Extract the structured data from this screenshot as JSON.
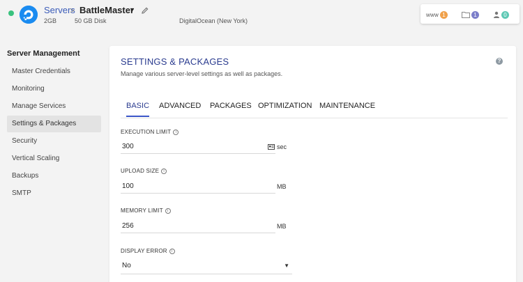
{
  "header": {
    "breadcrumb_root": "Servers",
    "breadcrumb_sep": ">",
    "server_name": "BattleMaster",
    "ram": "2GB",
    "disk": "50 GB Disk",
    "provider": "DigitalOcean (New York)",
    "status_color": "#3ac27e",
    "actions": {
      "www_label": "www",
      "www_count": "1",
      "files_count": "1",
      "users_count": "0"
    }
  },
  "sidebar": {
    "title": "Server Management",
    "items": [
      {
        "label": "Master Credentials"
      },
      {
        "label": "Monitoring"
      },
      {
        "label": "Manage Services"
      },
      {
        "label": "Settings & Packages",
        "active": true
      },
      {
        "label": "Security"
      },
      {
        "label": "Vertical Scaling"
      },
      {
        "label": "Backups"
      },
      {
        "label": "SMTP"
      }
    ]
  },
  "main": {
    "title": "SETTINGS & PACKAGES",
    "subtitle": "Manage various server-level settings as well as packages.",
    "help": "?",
    "tabs": [
      {
        "label": "BASIC",
        "active": true
      },
      {
        "label": "ADVANCED"
      },
      {
        "label": "PACKAGES"
      },
      {
        "label": "OPTIMIZATION"
      },
      {
        "label": "MAINTENANCE"
      }
    ],
    "fields": {
      "execution_limit": {
        "label": "EXECUTION LIMIT",
        "value": "300",
        "unit": "sec"
      },
      "upload_size": {
        "label": "UPLOAD SIZE",
        "value": "100",
        "unit": "MB"
      },
      "memory_limit": {
        "label": "MEMORY LIMIT",
        "value": "256",
        "unit": "MB"
      },
      "display_error": {
        "label": "DISPLAY ERROR",
        "value": "No"
      }
    }
  },
  "colors": {
    "accent": "#2a3b8f",
    "tab_underline": "#3a55c8",
    "badge_www": "#f0a14b",
    "badge_files": "#7b7ec9",
    "badge_users": "#5ec8b4",
    "logo": "#1a8bf0"
  }
}
